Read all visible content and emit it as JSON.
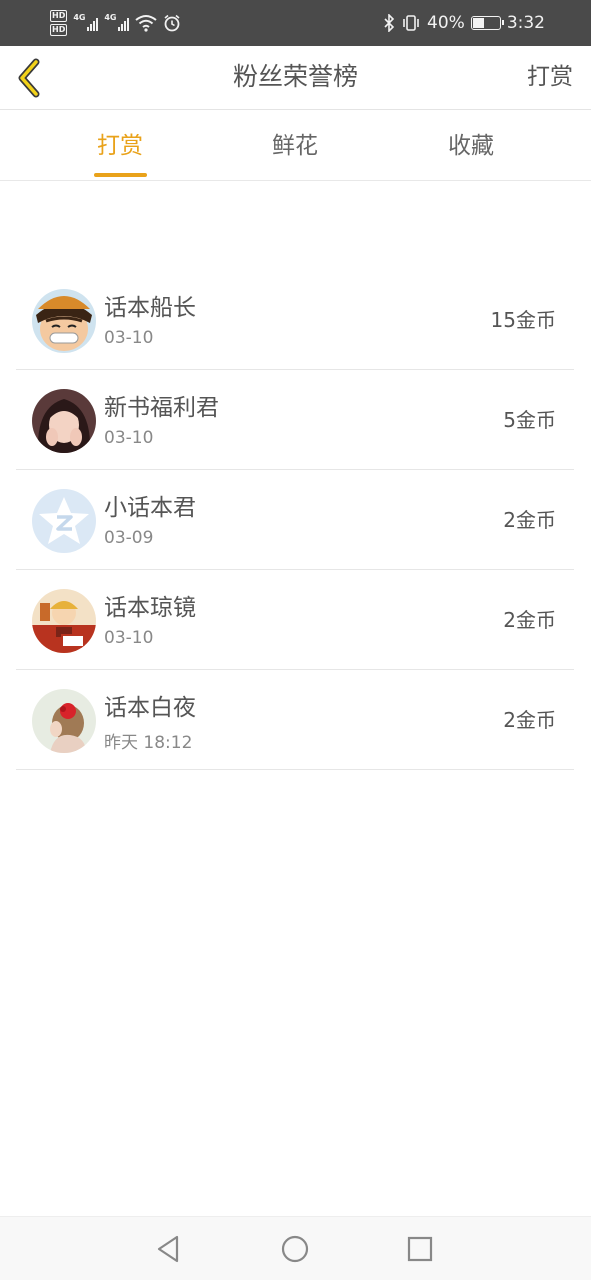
{
  "status_bar": {
    "hd1": "HD",
    "hd2": "HD",
    "net1": "4G",
    "net2": "4G",
    "battery": "40%",
    "time": "3:32"
  },
  "header": {
    "title": "粉丝荣誉榜",
    "right_action": "打赏"
  },
  "tabs": [
    {
      "label": "打赏",
      "active": true
    },
    {
      "label": "鲜花",
      "active": false
    },
    {
      "label": "收藏",
      "active": false
    }
  ],
  "colors": {
    "accent": "#e9a21a",
    "status_bar": "#4a4a4a"
  },
  "list": [
    {
      "name": "话本船长",
      "date": "03-10",
      "amount": "15金币",
      "avatar": "luffy-avatar"
    },
    {
      "name": "新书福利君",
      "date": "03-10",
      "amount": "5金币",
      "avatar": "girl-avatar"
    },
    {
      "name": "小话本君",
      "date": "03-09",
      "amount": "2金币",
      "avatar": "default-star-avatar"
    },
    {
      "name": "话本琼镜",
      "date": "03-10",
      "amount": "2金币",
      "avatar": "cartoon-avatar"
    },
    {
      "name": "话本白夜",
      "date": "昨天 18:12",
      "amount": "2金币",
      "avatar": "flower-hair-avatar"
    }
  ],
  "nav_icons": [
    "back-triangle-icon",
    "home-circle-icon",
    "recents-square-icon"
  ]
}
